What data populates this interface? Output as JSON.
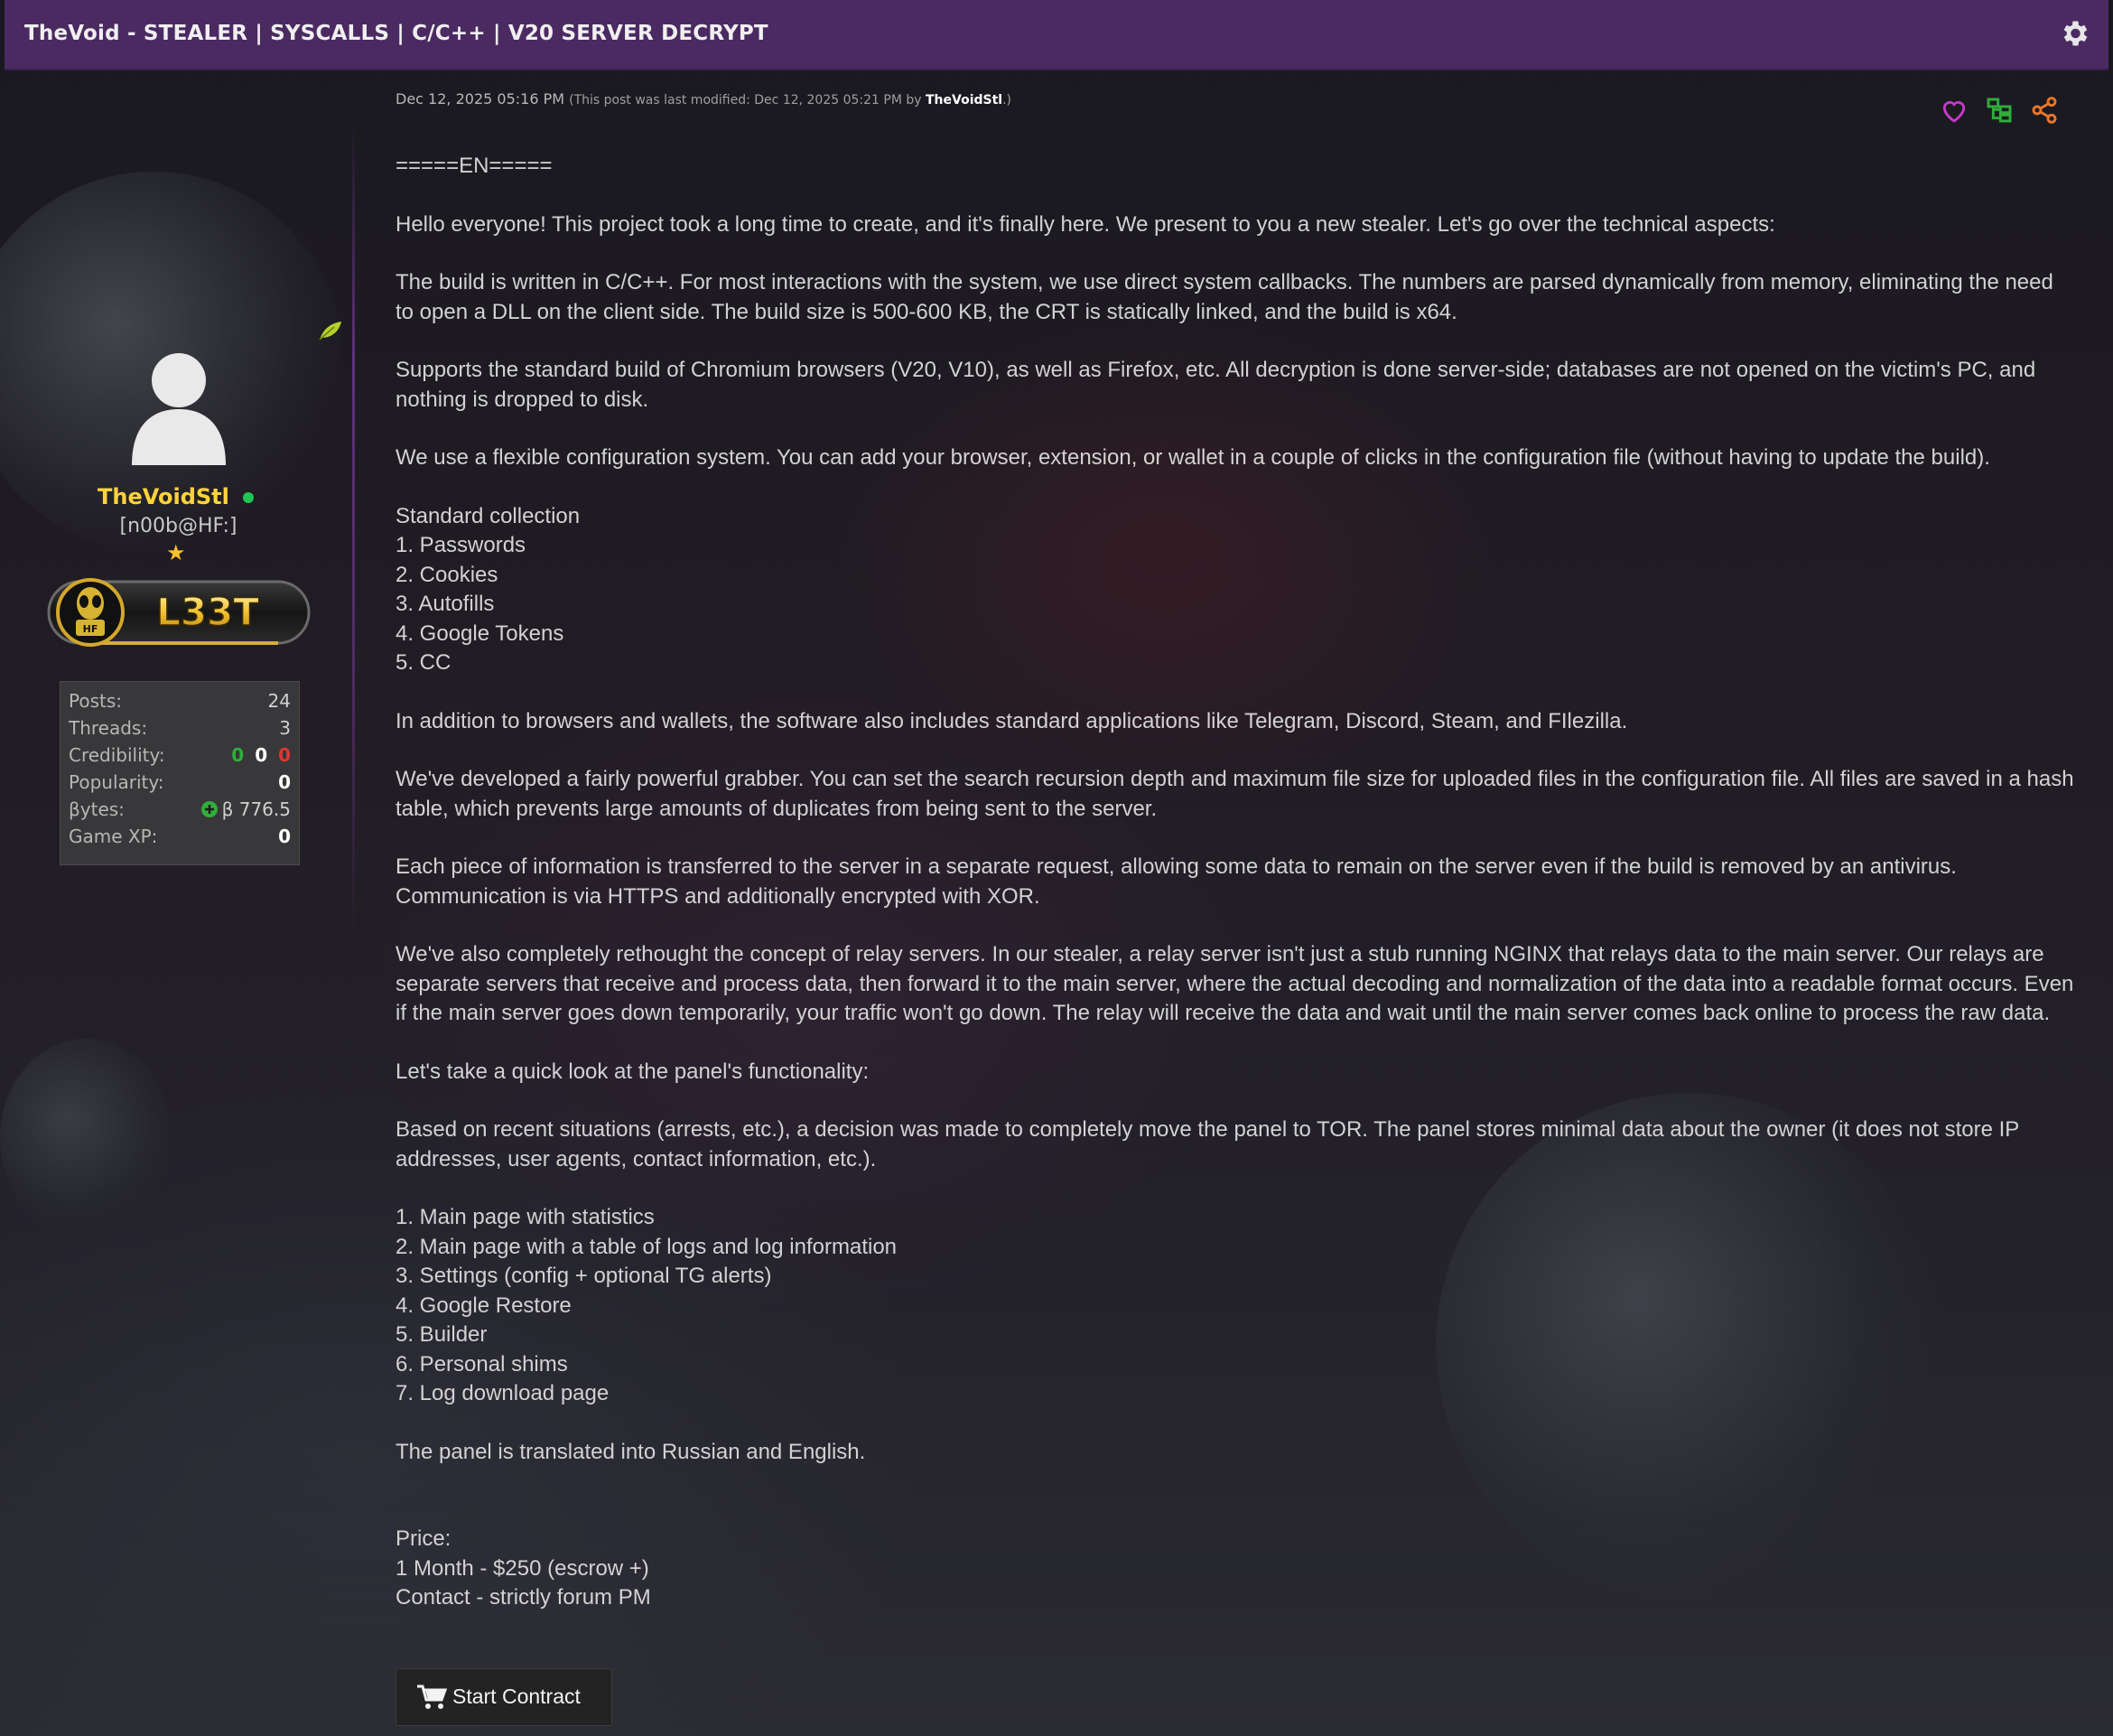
{
  "titlebar": {
    "title": "TheVoid - STEALER | SYSCALLS | C/C++ | V20 SERVER DECRYPT",
    "settings_icon": "gear-icon"
  },
  "author": {
    "username": "TheVoidStl",
    "user_title": "[n00b@HF:]",
    "rank_badge_text": "L33T",
    "rank_badge_sub": "HF",
    "online": true,
    "stats": [
      {
        "label": "Posts:",
        "value": "24"
      },
      {
        "label": "Threads:",
        "value": "3"
      },
      {
        "label": "Credibility:",
        "values": [
          "0",
          "0",
          "0"
        ]
      },
      {
        "label": "Popularity:",
        "value": "0"
      },
      {
        "label": "βytes:",
        "value": "β 776.5"
      },
      {
        "label": "Game XP:",
        "value": "0"
      }
    ]
  },
  "post": {
    "date": "Dec 12, 2025 05:16 PM",
    "modified_prefix": "(This post was last modified: Dec 12, 2025 05:21 PM by ",
    "modified_by": "TheVoidStl",
    "modified_suffix": ".)",
    "actions": [
      "heart-icon",
      "thread-tree-icon",
      "share-icon"
    ],
    "paragraphs": [
      "=====EN=====",
      "Hello everyone! This project took a long time to create, and it's finally here. We present to you a new stealer. Let's go over the technical aspects:",
      "The build is written in C/C++. For most interactions with the system, we use direct system callbacks. The numbers are parsed dynamically from memory, eliminating the need to open a DLL on the client side. The build size is 500-600 KB, the CRT is statically linked, and the build is x64.",
      "Supports the standard build of Chromium browsers (V20, V10), as well as Firefox, etc. All decryption is done server-side; databases are not opened on the victim's PC, and nothing is dropped to disk.",
      "We use a flexible configuration system. You can add your browser, extension, or wallet in a couple of clicks in the configuration file (without having to update the build)."
    ],
    "collection_heading": "Standard collection",
    "collection_items": [
      "1. Passwords",
      "2. Cookies",
      "3. Autofills",
      "4. Google Tokens",
      "5. CC"
    ],
    "paragraphs2": [
      "In addition to browsers and wallets, the software also includes standard applications like Telegram, Discord, Steam, and FIlezilla.",
      "We've developed a fairly powerful grabber. You can set the search recursion depth and maximum file size for uploaded files in the configuration file. All files are saved in a hash table, which prevents large amounts of duplicates from being sent to the server.",
      "Each piece of information is transferred to the server in a separate request, allowing some data to remain on the server even if the build is removed by an antivirus. Communication is via HTTPS and additionally encrypted with XOR.",
      "We've also completely rethought the concept of relay servers. In our stealer, a relay server isn't just a stub running NGINX that relays data to the main server. Our relays are separate servers that receive and process data, then forward it to the main server, where the actual decoding and normalization of the data into a readable format occurs. Even if the main server goes down temporarily, your traffic won't go down. The relay will receive the data and wait until the main server comes back online to process the raw data.",
      "Let's take a quick look at the panel's functionality:",
      "Based on recent situations (arrests, etc.), a decision was made to completely move the panel to TOR. The panel stores minimal data about the owner (it does not store IP addresses, user agents, contact information, etc.)."
    ],
    "panel_items": [
      "1. Main page with statistics",
      "2. Main page with a table of logs and log information",
      "3. Settings (config + optional TG alerts)",
      "4. Google Restore",
      "5. Builder",
      "6. Personal shims",
      "7. Log download page"
    ],
    "translation_note": "The panel is translated into Russian and English.",
    "price_lines": [
      "Price:",
      "1 Month - $250 (escrow +)",
      "Contact - strictly forum PM"
    ],
    "contract_button": "Start Contract"
  },
  "colors": {
    "titlebar": "#4b2a62",
    "username": "#ffd33a",
    "online": "#23c552",
    "heart": "#c23ac8",
    "tree": "#2fae3a",
    "share": "#e8762a"
  }
}
